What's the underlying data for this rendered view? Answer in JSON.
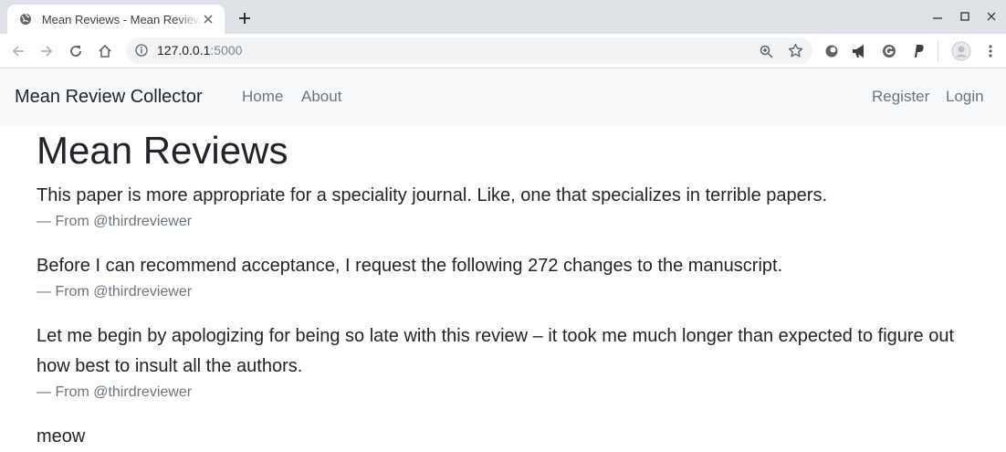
{
  "browser": {
    "tab": {
      "title": "Mean Reviews - Mean Reviews"
    },
    "url": {
      "host": "127.0.0.1",
      "port": ":5000"
    }
  },
  "navbar": {
    "brand": "Mean Review Collector",
    "links": [
      "Home",
      "About"
    ],
    "right_links": [
      "Register",
      "Login"
    ]
  },
  "main": {
    "title": "Mean Reviews",
    "reviews": [
      {
        "text": "This paper is more appropriate for a speciality journal. Like, one that specializes in terrible papers.",
        "footer": "— From @thirdreviewer"
      },
      {
        "text": "Before I can recommend acceptance, I request the following 272 changes to the manuscript.",
        "footer": "— From @thirdreviewer"
      },
      {
        "text": "Let me begin by apologizing for being so late with this review – it took me much longer than expected to figure out how best to insult all the authors.",
        "footer": "— From @thirdreviewer"
      },
      {
        "text": "meow"
      }
    ]
  },
  "colors": {
    "tabstrip": "#dee1e6",
    "navbar_bg": "#f8f9fa",
    "text": "#212529",
    "muted": "#6c757d"
  },
  "icons": [
    "globe-icon",
    "close-icon",
    "plus-icon",
    "minimize-icon",
    "maximize-icon",
    "window-close-icon",
    "back-icon",
    "forward-icon",
    "reload-icon",
    "home-icon",
    "info-icon",
    "zoom-icon",
    "star-icon",
    "extension-circle-icon",
    "megaphone-icon",
    "grammarly-icon",
    "paypal-icon",
    "profile-avatar-icon",
    "menu-dots-icon"
  ]
}
